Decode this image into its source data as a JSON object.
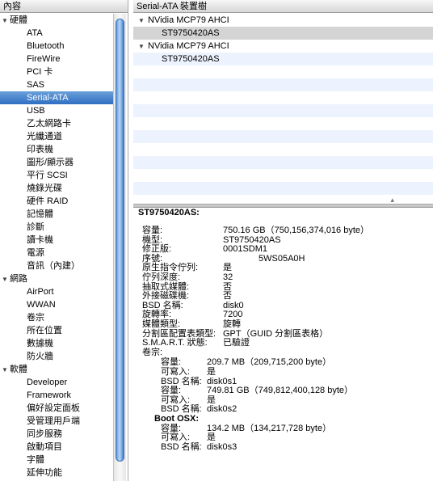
{
  "sidebar": {
    "header": "內容",
    "groups": [
      {
        "label": "硬體",
        "items": [
          "ATA",
          "Bluetooth",
          "FireWire",
          "PCI 卡",
          "SAS",
          "Serial-ATA",
          "USB",
          "乙太網路卡",
          "光纖通道",
          "印表機",
          "圖形/顯示器",
          "平行 SCSI",
          "燒錄光碟",
          "硬件 RAID",
          "記憶體",
          "診斷",
          "讀卡機",
          "電源",
          "音訊（內建）"
        ]
      },
      {
        "label": "網路",
        "items": [
          "AirPort",
          "WWAN",
          "卷宗",
          "所在位置",
          "數據機",
          "防火牆"
        ]
      },
      {
        "label": "軟體",
        "items": [
          "Developer",
          "Framework",
          "偏好設定面板",
          "受管理用戶端",
          "同步服務",
          "啟動項目",
          "字體",
          "延伸功能"
        ]
      }
    ],
    "selected": "Serial-ATA"
  },
  "device_tree": {
    "header": "Serial-ATA 裝置樹",
    "rows": [
      {
        "type": "group",
        "label": "NVidia MCP79 AHCI"
      },
      {
        "type": "child",
        "label": "ST9750420AS",
        "selected": true
      },
      {
        "type": "group",
        "label": "NVidia MCP79 AHCI"
      },
      {
        "type": "child",
        "label": "ST9750420AS",
        "selected": false
      }
    ],
    "empty_rows": 10
  },
  "detail": {
    "title": "ST9750420AS:",
    "fields": [
      {
        "k": "容量:",
        "v": "750.16 GB（750,156,374,016 byte）"
      },
      {
        "k": "機型:",
        "v": "ST9750420AS"
      },
      {
        "k": "修正版:",
        "v": "0001SDM1"
      },
      {
        "k": "序號:",
        "v": "5WS05A0H"
      },
      {
        "k": "原生指令佇列:",
        "v": "是"
      },
      {
        "k": "佇列深度:",
        "v": "32"
      },
      {
        "k": "抽取式媒體:",
        "v": "否"
      },
      {
        "k": "外接磁碟機:",
        "v": "否"
      },
      {
        "k": "BSD 名稱:",
        "v": "disk0"
      },
      {
        "k": "旋轉率:",
        "v": "7200"
      },
      {
        "k": "媒體類型:",
        "v": "旋轉"
      },
      {
        "k": "分割區配置表類型:",
        "v": "GPT（GUID 分割區表格）"
      },
      {
        "k": "S.M.A.R.T. 狀態:",
        "v": "已驗證"
      },
      {
        "k": "卷宗:",
        "v": ""
      }
    ],
    "volumes": [
      {
        "name": "",
        "size_label": "容量:",
        "size": "209.7 MB（209,715,200 byte）",
        "w_label": "可寫入:",
        "w": "是",
        "bsd_label": "BSD 名稱:",
        "bsd": "disk0s1"
      },
      {
        "name": "",
        "size_label": "容量:",
        "size": "749.81 GB（749,812,400,128 byte）",
        "w_label": "可寫入:",
        "w": "是",
        "bsd_label": "BSD 名稱:",
        "bsd": "disk0s2"
      },
      {
        "name": "Boot OSX:",
        "size_label": "容量:",
        "size": "134.2 MB（134,217,728 byte）",
        "w_label": "可寫入:",
        "w": "是",
        "bsd_label": "BSD 名稱:",
        "bsd": "disk0s3"
      }
    ]
  }
}
